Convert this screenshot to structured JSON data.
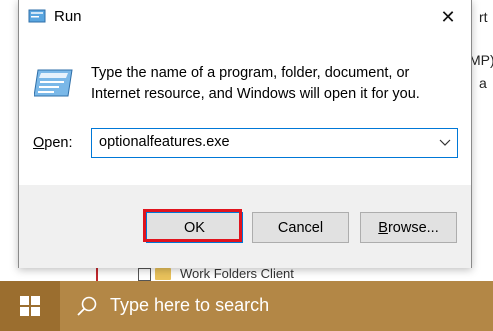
{
  "background": {
    "right_fragments": [
      "rt",
      "MP)",
      "a"
    ],
    "partial_item": "Work Folders Client"
  },
  "dialog": {
    "title": "Run",
    "close_glyph": "✕",
    "description": "Type the name of a program, folder, document, or Internet resource, and Windows will open it for you.",
    "open_label_accel": "O",
    "open_label_rest": "pen:",
    "open_value": "optionalfeatures.exe",
    "buttons": {
      "ok": "OK",
      "cancel": "Cancel",
      "browse_accel": "B",
      "browse_rest": "rowse..."
    },
    "highlight_color": "#e0141e"
  },
  "taskbar": {
    "search_placeholder": "Type here to search",
    "color": "#9b6e2f"
  }
}
